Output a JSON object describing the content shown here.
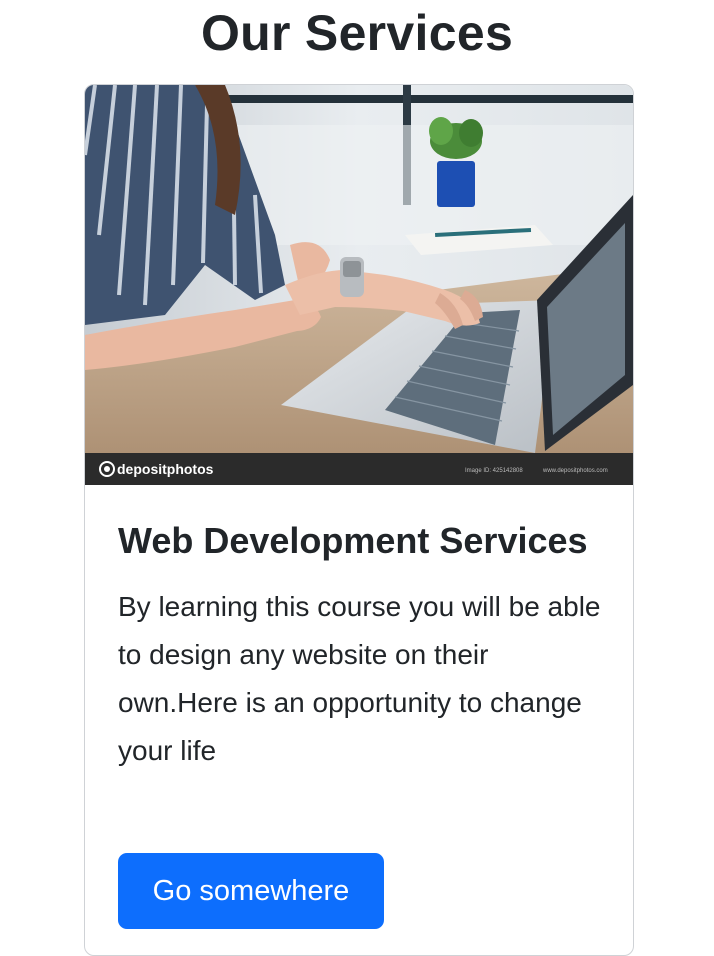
{
  "header": {
    "title": "Our Services"
  },
  "card": {
    "image": {
      "watermark": "depositphotos",
      "image_id": "Image ID: 425142808",
      "site": "www.depositphotos.com"
    },
    "title": "Web Development Services",
    "text": "By learning this course you will be able to design any website on their own.Here is an opportunity to change your life",
    "button_label": "Go somewhere"
  },
  "colors": {
    "primary_button": "#0d6efd",
    "text": "#212529",
    "card_border": "#cfd2d6"
  }
}
